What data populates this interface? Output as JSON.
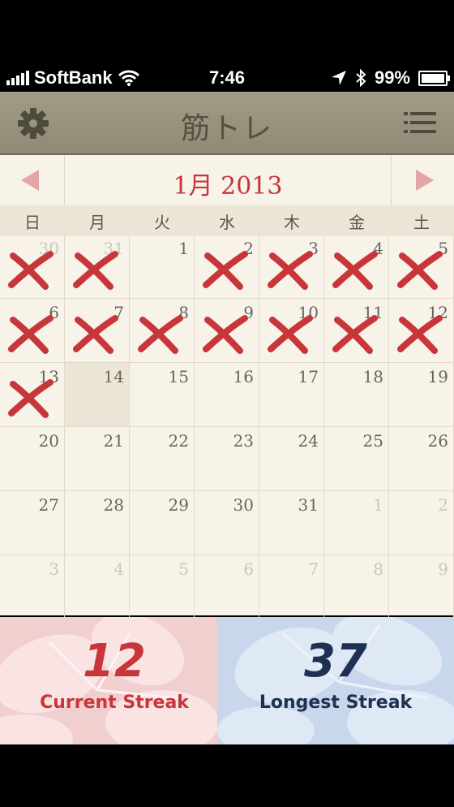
{
  "status_bar": {
    "carrier": "SoftBank",
    "time": "7:46",
    "battery": "99%",
    "battery_level": 0.99,
    "icons": [
      "signal-icon",
      "wifi-icon",
      "location-icon",
      "bluetooth-icon",
      "battery-icon"
    ]
  },
  "nav": {
    "title": "筋トレ",
    "left_icon": "gear-icon",
    "right_icon": "list-icon"
  },
  "calendar": {
    "month_label": "1月 2013",
    "weekdays": [
      "日",
      "月",
      "火",
      "水",
      "木",
      "金",
      "土"
    ],
    "weeks": [
      [
        {
          "d": "30",
          "other": true,
          "x": true
        },
        {
          "d": "31",
          "other": true,
          "x": true
        },
        {
          "d": "1"
        },
        {
          "d": "2",
          "x": true
        },
        {
          "d": "3",
          "x": true
        },
        {
          "d": "4",
          "x": true
        },
        {
          "d": "5",
          "x": true
        }
      ],
      [
        {
          "d": "6",
          "x": true
        },
        {
          "d": "7",
          "x": true
        },
        {
          "d": "8",
          "x": true
        },
        {
          "d": "9",
          "x": true
        },
        {
          "d": "10",
          "x": true
        },
        {
          "d": "11",
          "x": true
        },
        {
          "d": "12",
          "x": true
        }
      ],
      [
        {
          "d": "13",
          "x": true
        },
        {
          "d": "14",
          "today": true
        },
        {
          "d": "15"
        },
        {
          "d": "16"
        },
        {
          "d": "17"
        },
        {
          "d": "18"
        },
        {
          "d": "19"
        }
      ],
      [
        {
          "d": "20"
        },
        {
          "d": "21"
        },
        {
          "d": "22"
        },
        {
          "d": "23"
        },
        {
          "d": "24"
        },
        {
          "d": "25"
        },
        {
          "d": "26"
        }
      ],
      [
        {
          "d": "27"
        },
        {
          "d": "28"
        },
        {
          "d": "29"
        },
        {
          "d": "30"
        },
        {
          "d": "31"
        },
        {
          "d": "1",
          "other": true
        },
        {
          "d": "2",
          "other": true
        }
      ],
      [
        {
          "d": "3",
          "other": true
        },
        {
          "d": "4",
          "other": true
        },
        {
          "d": "5",
          "other": true
        },
        {
          "d": "6",
          "other": true
        },
        {
          "d": "7",
          "other": true
        },
        {
          "d": "8",
          "other": true
        },
        {
          "d": "9",
          "other": true
        }
      ]
    ]
  },
  "streaks": {
    "current": {
      "value": "12",
      "label": "Current Streak"
    },
    "longest": {
      "value": "37",
      "label": "Longest Streak"
    }
  },
  "colors": {
    "accent_red": "#c8353a",
    "navy": "#1f3152",
    "paper": "#f7f3e9",
    "navbar": "#9a9581"
  }
}
